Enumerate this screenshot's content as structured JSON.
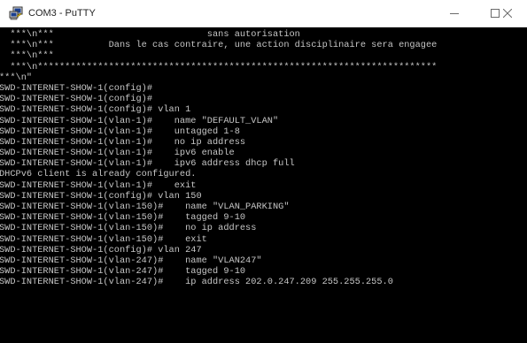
{
  "window": {
    "title": "COM3 - PuTTY",
    "icon": "putty-computer-icon",
    "controls": {
      "minimize_icon": "minimize-icon",
      "maximize_icon": "maximize-icon",
      "close_icon": "close-icon"
    }
  },
  "terminal": {
    "background": "#000000",
    "foreground": "#c6c6c6",
    "lines": [
      "  ***\\n***                            sans autorisation",
      "  ***\\n***          Dans le cas contraire, une action disciplinaire sera engagee",
      "  ***\\n***",
      "  ***\\n*************************************************************************",
      "***\\n\"",
      "SWD-INTERNET-SHOW-1(config)#",
      "SWD-INTERNET-SHOW-1(config)#",
      "SWD-INTERNET-SHOW-1(config)# vlan 1",
      "SWD-INTERNET-SHOW-1(vlan-1)#    name \"DEFAULT_VLAN\"",
      "SWD-INTERNET-SHOW-1(vlan-1)#    untagged 1-8",
      "SWD-INTERNET-SHOW-1(vlan-1)#    no ip address",
      "SWD-INTERNET-SHOW-1(vlan-1)#    ipv6 enable",
      "SWD-INTERNET-SHOW-1(vlan-1)#    ipv6 address dhcp full",
      "DHCPv6 client is already configured.",
      "SWD-INTERNET-SHOW-1(vlan-1)#    exit",
      "SWD-INTERNET-SHOW-1(config)# vlan 150",
      "SWD-INTERNET-SHOW-1(vlan-150)#    name \"VLAN_PARKING\"",
      "SWD-INTERNET-SHOW-1(vlan-150)#    tagged 9-10",
      "SWD-INTERNET-SHOW-1(vlan-150)#    no ip address",
      "SWD-INTERNET-SHOW-1(vlan-150)#    exit",
      "SWD-INTERNET-SHOW-1(config)# vlan 247",
      "SWD-INTERNET-SHOW-1(vlan-247)#    name \"VLAN247\"",
      "SWD-INTERNET-SHOW-1(vlan-247)#    tagged 9-10",
      "SWD-INTERNET-SHOW-1(vlan-247)#    ip address 202.0.247.209 255.255.255.0"
    ]
  }
}
